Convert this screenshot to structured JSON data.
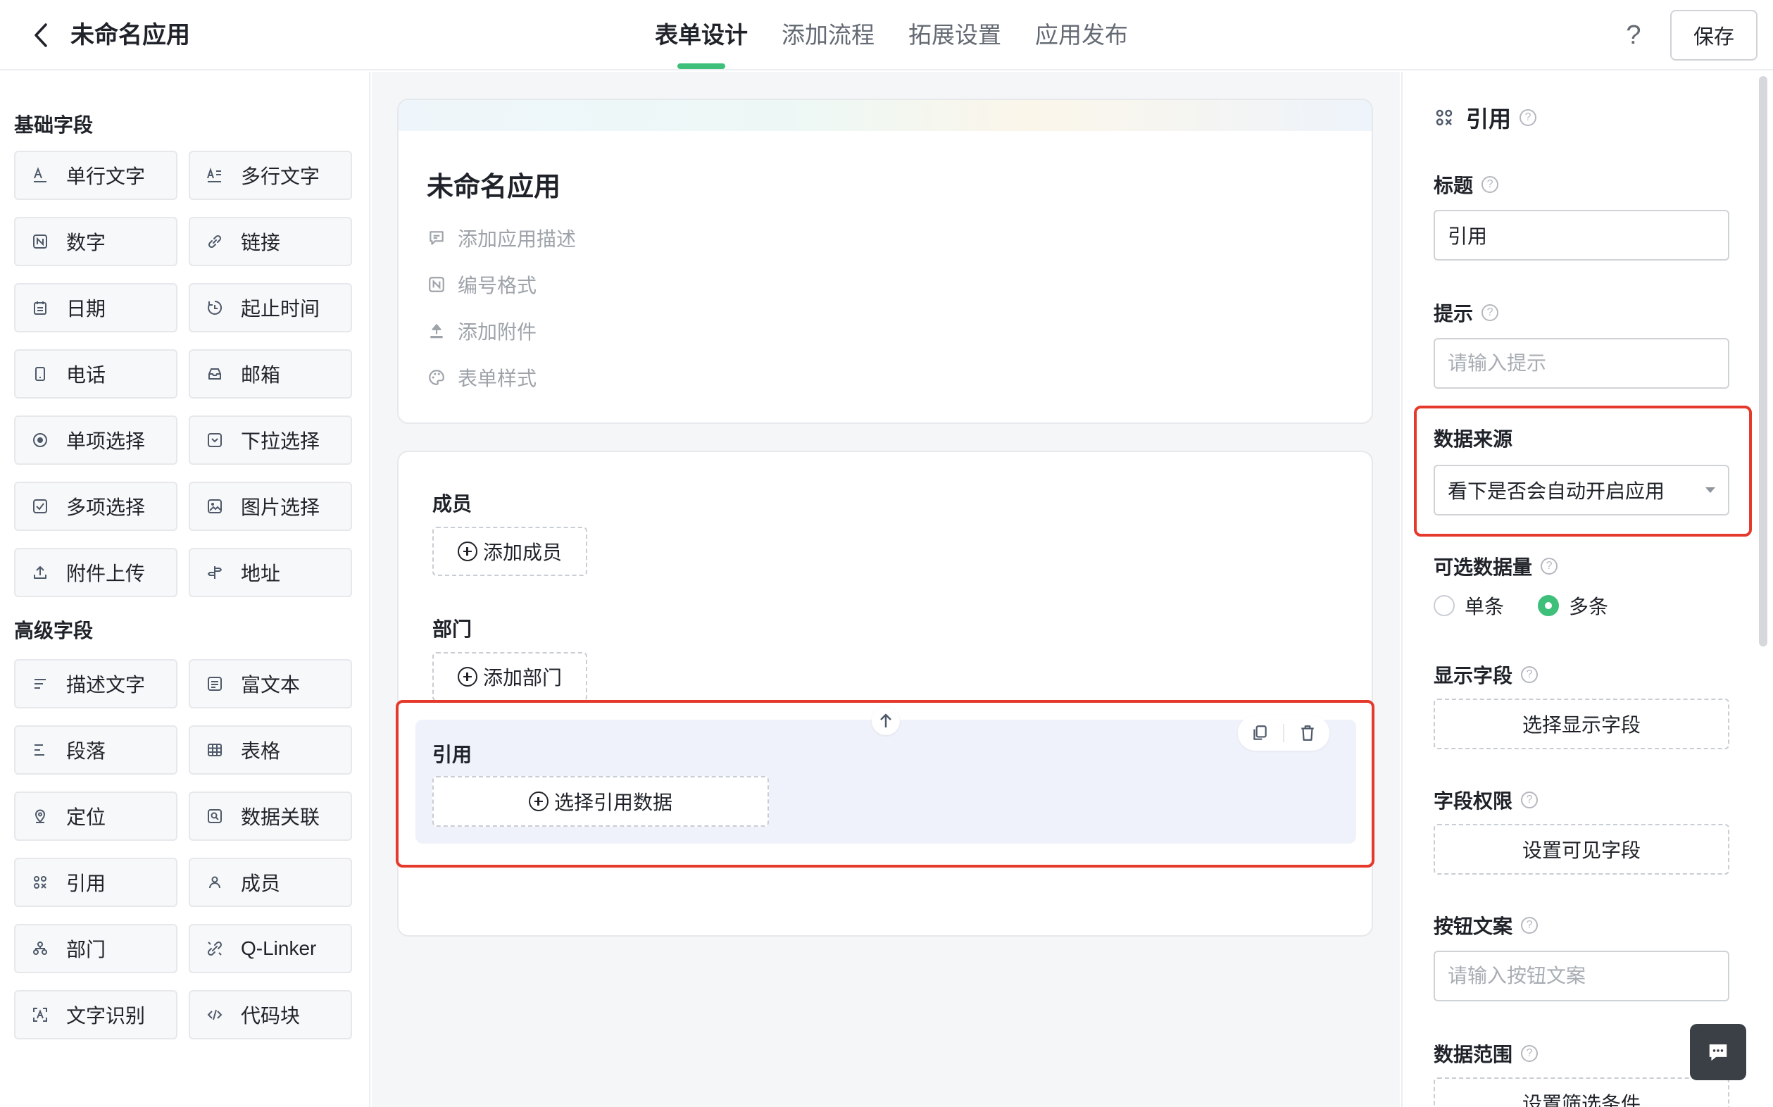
{
  "header": {
    "app_title": "未命名应用",
    "tabs": [
      {
        "label": "表单设计",
        "active": true
      },
      {
        "label": "添加流程",
        "active": false
      },
      {
        "label": "拓展设置",
        "active": false
      },
      {
        "label": "应用发布",
        "active": false
      }
    ],
    "help_label": "?",
    "save_label": "保存"
  },
  "left_panel": {
    "basic_title": "基础字段",
    "basic_fields": [
      {
        "label": "单行文字",
        "icon": "single-line-text-icon"
      },
      {
        "label": "多行文字",
        "icon": "multi-line-text-icon"
      },
      {
        "label": "数字",
        "icon": "number-icon"
      },
      {
        "label": "链接",
        "icon": "link-icon"
      },
      {
        "label": "日期",
        "icon": "calendar-icon"
      },
      {
        "label": "起止时间",
        "icon": "time-range-icon"
      },
      {
        "label": "电话",
        "icon": "phone-icon"
      },
      {
        "label": "邮箱",
        "icon": "mailbox-icon"
      },
      {
        "label": "单项选择",
        "icon": "radio-icon"
      },
      {
        "label": "下拉选择",
        "icon": "dropdown-icon"
      },
      {
        "label": "多项选择",
        "icon": "checkbox-icon"
      },
      {
        "label": "图片选择",
        "icon": "image-icon"
      },
      {
        "label": "附件上传",
        "icon": "upload-icon"
      },
      {
        "label": "地址",
        "icon": "signpost-icon"
      }
    ],
    "advanced_title": "高级字段",
    "advanced_fields": [
      {
        "label": "描述文字",
        "icon": "description-icon"
      },
      {
        "label": "富文本",
        "icon": "rich-text-icon"
      },
      {
        "label": "段落",
        "icon": "paragraph-icon"
      },
      {
        "label": "表格",
        "icon": "table-icon"
      },
      {
        "label": "定位",
        "icon": "location-icon"
      },
      {
        "label": "数据关联",
        "icon": "data-link-icon"
      },
      {
        "label": "引用",
        "icon": "reference-icon"
      },
      {
        "label": "成员",
        "icon": "member-icon"
      },
      {
        "label": "部门",
        "icon": "department-icon"
      },
      {
        "label": "Q-Linker",
        "icon": "q-linker-icon"
      },
      {
        "label": "文字识别",
        "icon": "ocr-icon"
      },
      {
        "label": "代码块",
        "icon": "code-icon"
      }
    ]
  },
  "canvas": {
    "form_title": "未命名应用",
    "meta_items": [
      {
        "label": "添加应用描述",
        "icon": "comment-icon"
      },
      {
        "label": "编号格式",
        "icon": "number-format-icon"
      },
      {
        "label": "添加附件",
        "icon": "upload-icon"
      },
      {
        "label": "表单样式",
        "icon": "palette-icon"
      }
    ],
    "fields": [
      {
        "label": "成员",
        "button": "添加成员"
      },
      {
        "label": "部门",
        "button": "添加部门"
      },
      {
        "label": "引用",
        "button": "选择引用数据"
      }
    ]
  },
  "right_panel": {
    "title": "引用",
    "title_label": "标题",
    "title_value": "引用",
    "hint_label": "提示",
    "hint_placeholder": "请输入提示",
    "source_label": "数据来源",
    "source_value": "看下是否会自动开启应用",
    "quantity_label": "可选数据量",
    "quantity_options": [
      {
        "label": "单条",
        "checked": false
      },
      {
        "label": "多条",
        "checked": true
      }
    ],
    "display_label": "显示字段",
    "display_button": "选择显示字段",
    "permission_label": "字段权限",
    "permission_button": "设置可见字段",
    "button_text_label": "按钮文案",
    "button_text_placeholder": "请输入按钮文案",
    "range_label": "数据范围",
    "range_button": "设置筛选条件"
  },
  "colors": {
    "accent": "#3ec07a",
    "highlight_border": "#e5392c",
    "selected_bg": "#eff2fb"
  }
}
